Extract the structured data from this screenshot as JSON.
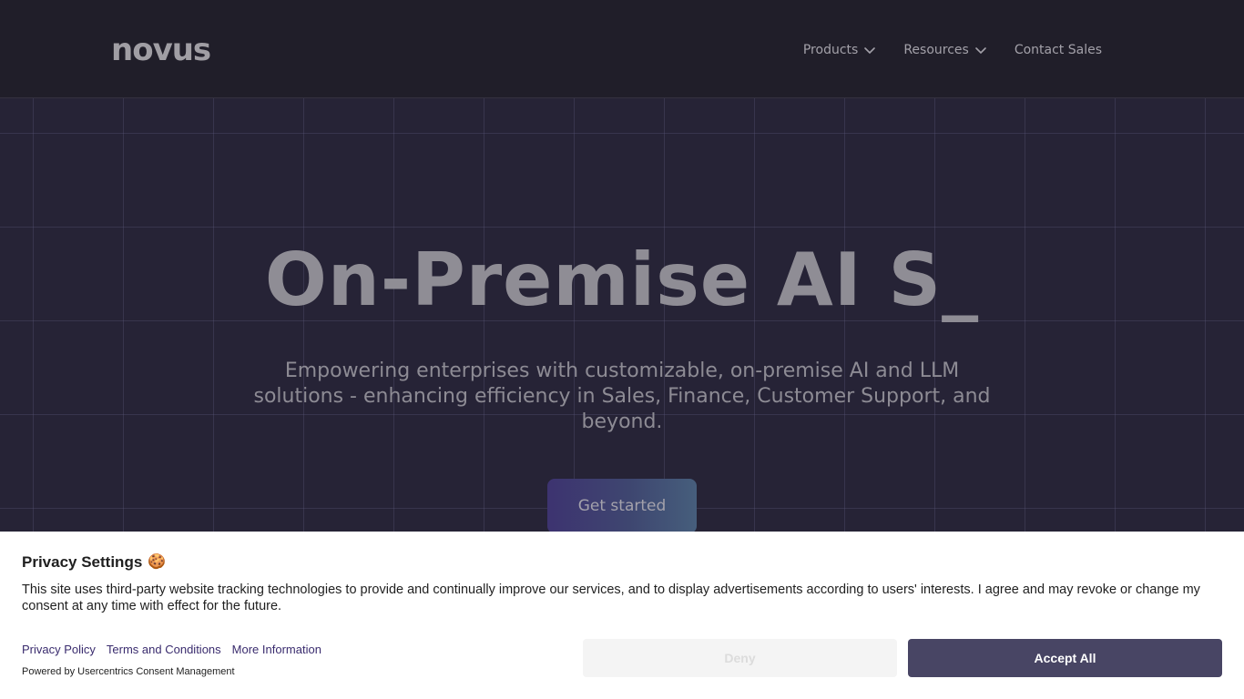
{
  "header": {
    "logo_text": "novus",
    "nav": {
      "products": "Products",
      "resources": "Resources",
      "contact": "Contact Sales"
    }
  },
  "hero": {
    "title": "On-Premise AI S_",
    "subtitle": "Empowering enterprises with customizable, on-premise AI and LLM solutions - enhancing efficiency in Sales, Finance, Customer Support, and beyond.",
    "cta": "Get started"
  },
  "consent": {
    "title": "Privacy Settings",
    "title_icon": "🍪",
    "text": "This site uses third-party website tracking technologies to provide and continually improve our services, and to display advertisements according to users' interests. I agree and may revoke or change my consent at any time with effect for the future.",
    "links": {
      "privacy": "Privacy Policy",
      "terms": "Terms and Conditions",
      "more": "More Information"
    },
    "powered_by": "Powered by Usercentrics Consent Management",
    "deny": "Deny",
    "accept": "Accept All"
  },
  "colors": {
    "header_bg": "#201e29",
    "hero_bg": "#262336",
    "accent_button": "#484564",
    "link": "#3a2c6e"
  }
}
